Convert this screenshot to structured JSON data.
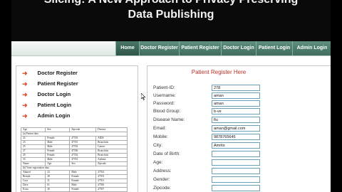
{
  "header": {
    "title_line1": "Slicing: A New Approach to Privacy Preserving",
    "title_line2": "Data Publishing"
  },
  "nav": {
    "items": [
      "Home",
      "Doctor Register",
      "Patient Register",
      "Doctor Login",
      "Patient Login",
      "Admin Login"
    ]
  },
  "sidebar": {
    "items": [
      "Doctor Register",
      "Patient Register",
      "Doctor Login",
      "Patient Login",
      "Admin Login"
    ]
  },
  "mini_table": {
    "header1": [
      "Age",
      "Sex",
      "Zipcode",
      "Disease"
    ],
    "section1": "(a) Patient data",
    "rows1": [
      [
        "22",
        "Female",
        "47553",
        "AIDS"
      ],
      [
        "23",
        "Male",
        "47551",
        "Bronchitis"
      ],
      [
        "25",
        "Male",
        "47552",
        "Cancer"
      ],
      [
        "27",
        "Female",
        "47556",
        "Bronchitis"
      ],
      [
        "29",
        "Female",
        "47552",
        "Bronchitis"
      ],
      [
        "33",
        "Male",
        "47551",
        "Asthma"
      ]
    ],
    "header2": [
      "Name",
      "Age",
      "Sex",
      "Zipcode"
    ],
    "section2": "(b) Voter registration data",
    "rows2": [
      [
        "Ahmed",
        "23",
        "Male",
        "47552"
      ],
      [
        "Brenda",
        "28",
        "Female",
        "47553"
      ],
      [
        "Cora",
        "21",
        "Female",
        "47551"
      ],
      [
        "Dave",
        "61",
        "Male",
        "47556"
      ],
      [
        "Evita",
        "40",
        "Female",
        "47557"
      ]
    ]
  },
  "form": {
    "title": "Patient Register Here",
    "fields": [
      {
        "label": "Patient-ID:",
        "value": "278"
      },
      {
        "label": "Username:",
        "value": "aman"
      },
      {
        "label": "Password:",
        "value": "aman"
      },
      {
        "label": "Blood Group:",
        "value": "b-ve"
      },
      {
        "label": "Disease Name:",
        "value": "flu"
      },
      {
        "label": "Email:",
        "value": "aman@gmail.com"
      },
      {
        "label": "Mobile:",
        "value": "9878765645"
      },
      {
        "label": "City:",
        "value": "Amrits"
      },
      {
        "label": "Date of Birth:",
        "value": ""
      },
      {
        "label": "Age:",
        "value": ""
      },
      {
        "label": "Address:",
        "value": ""
      },
      {
        "label": "Gender:",
        "value": ""
      },
      {
        "label": "Zipcode:",
        "value": ""
      }
    ]
  }
}
